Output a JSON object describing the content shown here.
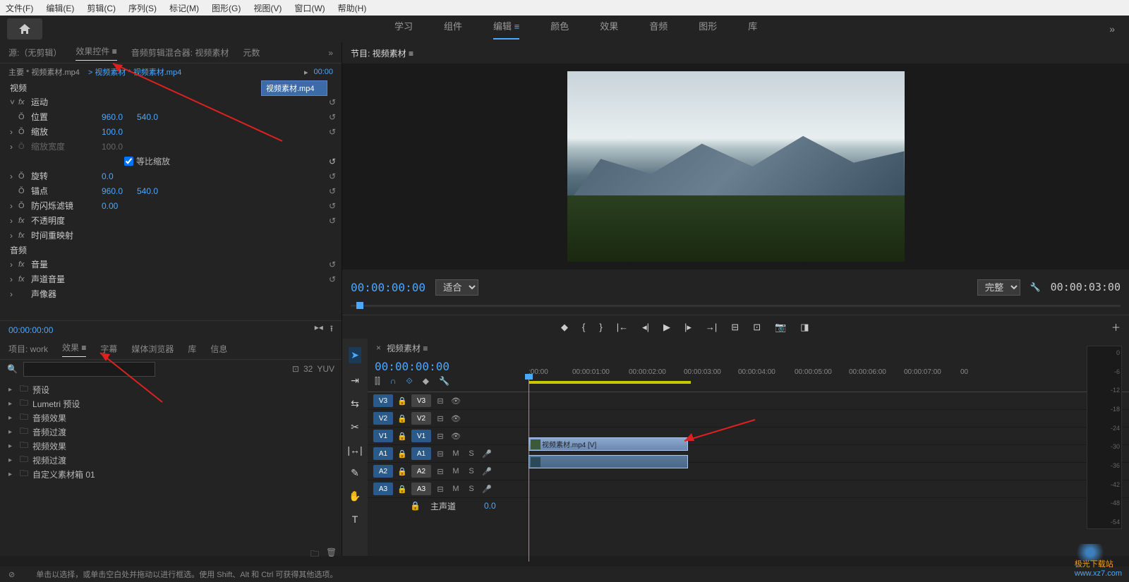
{
  "menubar": [
    "文件(F)",
    "编辑(E)",
    "剪辑(C)",
    "序列(S)",
    "标记(M)",
    "图形(G)",
    "视图(V)",
    "窗口(W)",
    "帮助(H)"
  ],
  "workspaces": {
    "items": [
      "学习",
      "组件",
      "编辑",
      "颜色",
      "效果",
      "音频",
      "图形",
      "库"
    ],
    "active": 2,
    "overflow": "»"
  },
  "source_panel": {
    "tabs": {
      "source": "源:（无剪辑）",
      "effect_controls": "效果控件",
      "audio_mixer": "音频剪辑混合器: 视频素材",
      "metadata_short": "元数",
      "overflow": "»"
    },
    "header": {
      "master_clip": "主要 * 视频素材.mp4",
      "sequence_clip": "视频素材 * 视频素材.mp4",
      "start_tc": "00:00"
    },
    "clip_label": "视频素材.mp4",
    "sections": {
      "video": "视频",
      "motion": "运动",
      "position": "位置",
      "position_x": "960.0",
      "position_y": "540.0",
      "scale": "缩放",
      "scale_val": "100.0",
      "scale_width": "缩放宽度",
      "scale_width_val": "100.0",
      "uniform_scale": "等比缩放",
      "rotation": "旋转",
      "rotation_val": "0.0",
      "anchor": "锚点",
      "anchor_x": "960.0",
      "anchor_y": "540.0",
      "flicker": "防闪烁滤镜",
      "flicker_val": "0.00",
      "opacity": "不透明度",
      "time_remap": "时间重映射",
      "audio": "音频",
      "volume": "音量",
      "channel_volume": "声道音量",
      "panner": "声像器"
    },
    "footer_tc": "00:00:00:00"
  },
  "program_panel": {
    "title": "节目: 视频素材",
    "current_tc": "00:00:00:00",
    "fit": "适合",
    "quality": "完整",
    "duration": "00:00:03:00"
  },
  "project_panel": {
    "tabs": {
      "project": "项目: work",
      "effects": "效果",
      "captions": "字幕",
      "media_browser": "媒体浏览器",
      "libraries": "库",
      "info": "信息"
    },
    "search_placeholder": "",
    "badges": [
      "⊡",
      "32",
      "YUV"
    ],
    "tree": [
      "预设",
      "Lumetri 预设",
      "音频效果",
      "音频过渡",
      "视频效果",
      "视频过渡",
      "自定义素材箱 01"
    ]
  },
  "timeline": {
    "tab": "视频素材",
    "tc": "00:00:00:00",
    "ruler": [
      ":00:00",
      "00:00:01:00",
      "00:00:02:00",
      "00:00:03:00",
      "00:00:04:00",
      "00:00:05:00",
      "00:00:06:00",
      "00:00:07:00",
      "00"
    ],
    "tracks": {
      "v3": "V3",
      "v3h": "V3",
      "v2": "V2",
      "v2h": "V2",
      "v1": "V1",
      "v1h": "V1",
      "a1": "A1",
      "a1h": "A1",
      "a2": "A2",
      "a2h": "A2",
      "a3": "A3",
      "a3h": "A3"
    },
    "clip_name": "视频素材.mp4 [V]",
    "master": {
      "lock": "🔒",
      "label": "主声道",
      "val": "0.0"
    }
  },
  "meter_scale": [
    "0",
    "-6",
    "-12",
    "-18",
    "-24",
    "-30",
    "-36",
    "-42",
    "-48",
    "-54"
  ],
  "statusbar": {
    "hint": "单击以选择，或单击空白处并拖动以进行框选。使用 Shift、Alt 和 Ctrl 可获得其他选项。"
  },
  "watermark": {
    "text": "www.xz7.com",
    "brand": "极光下载站"
  }
}
